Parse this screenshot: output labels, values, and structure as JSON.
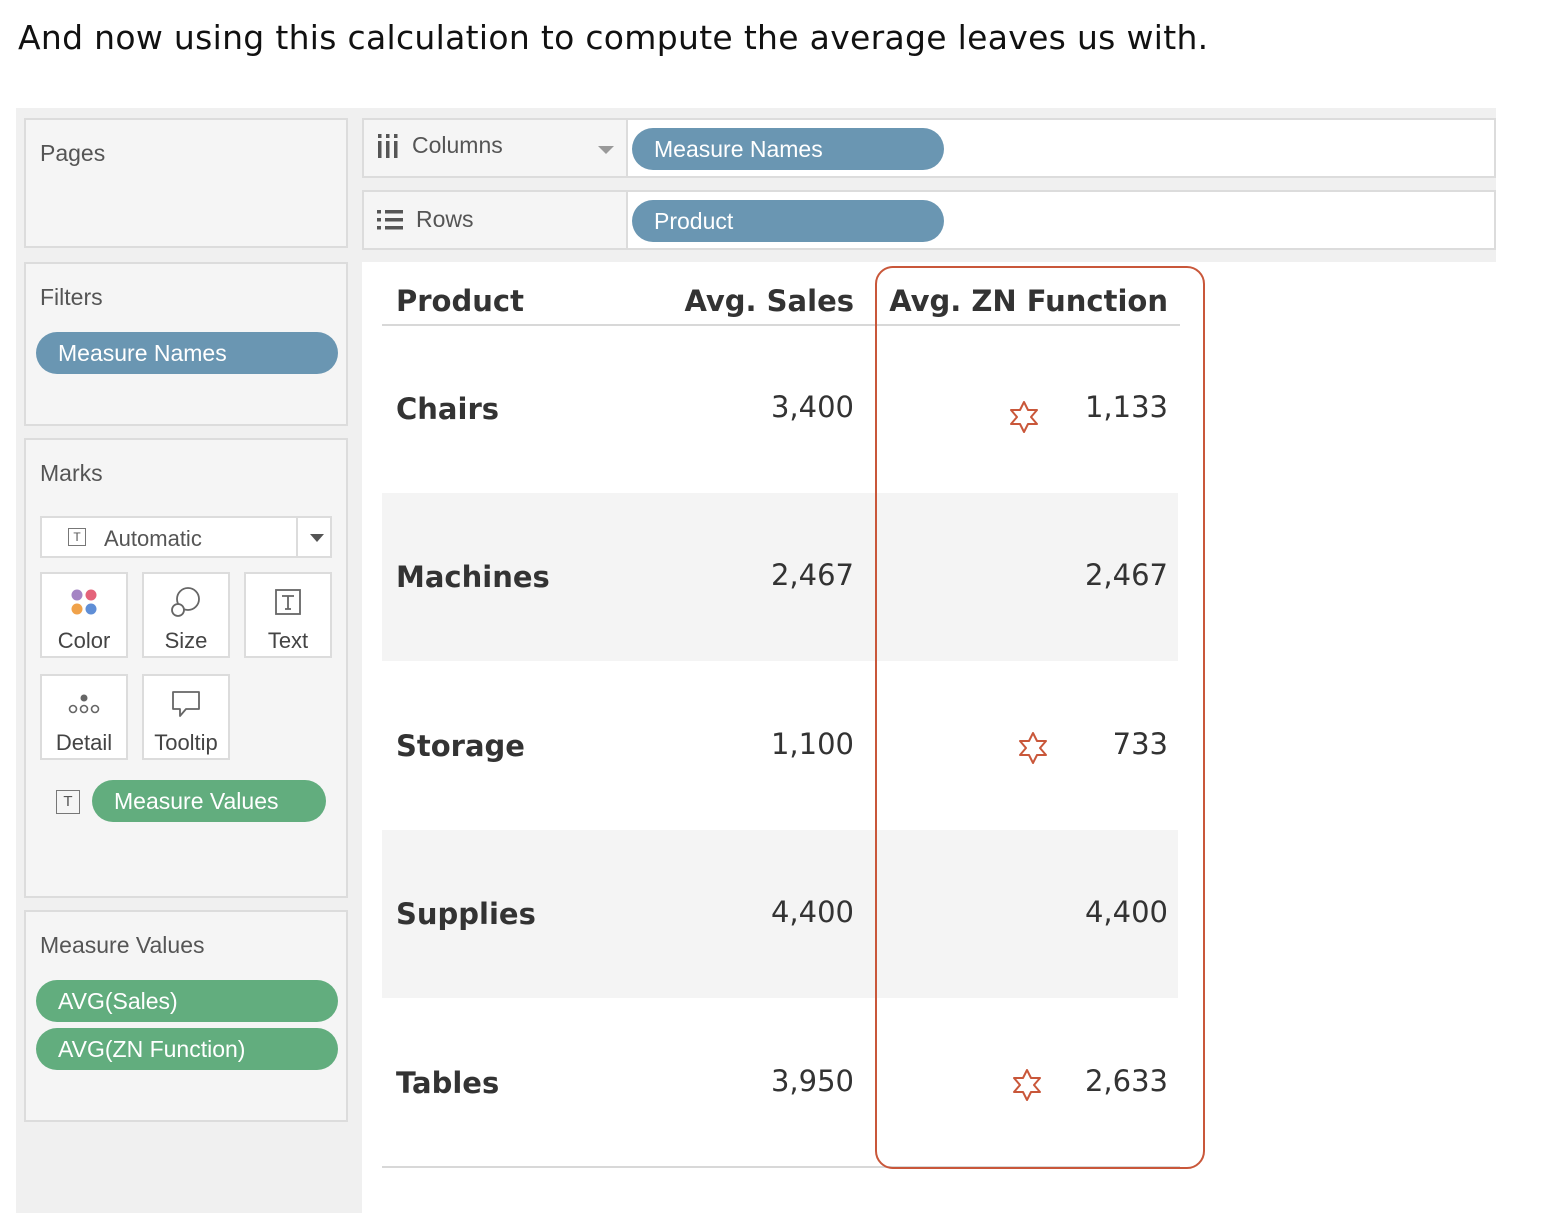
{
  "caption": "And now using this calculation to compute the average leaves us with.",
  "pages": {
    "title": "Pages"
  },
  "filters": {
    "title": "Filters",
    "pill": "Measure Names"
  },
  "marks": {
    "title": "Marks",
    "type": "Automatic",
    "cards": {
      "color": "Color",
      "size": "Size",
      "text": "Text",
      "detail": "Detail",
      "tooltip": "Tooltip"
    },
    "text_pill": "Measure Values"
  },
  "measure_values": {
    "title": "Measure Values",
    "pills": [
      "AVG(Sales)",
      "AVG(ZN Function)"
    ]
  },
  "shelves": {
    "columns": {
      "label": "Columns",
      "pill": "Measure Names"
    },
    "rows": {
      "label": "Rows",
      "pill": "Product"
    }
  },
  "table": {
    "headers": {
      "product": "Product",
      "sales": "Avg. Sales",
      "zn": "Avg. ZN Function"
    },
    "rows": [
      {
        "product": "Chairs",
        "sales": "3,400",
        "zn": "1,133",
        "flag": true
      },
      {
        "product": "Machines",
        "sales": "2,467",
        "zn": "2,467",
        "flag": false
      },
      {
        "product": "Storage",
        "sales": "1,100",
        "zn": "733",
        "flag": true
      },
      {
        "product": "Supplies",
        "sales": "4,400",
        "zn": "4,400",
        "flag": false
      },
      {
        "product": "Tables",
        "sales": "3,950",
        "zn": "2,633",
        "flag": true
      }
    ]
  },
  "colors": {
    "pill_blue": "#6a96b2",
    "pill_green": "#62ad7e",
    "highlight": "#c9573a"
  }
}
